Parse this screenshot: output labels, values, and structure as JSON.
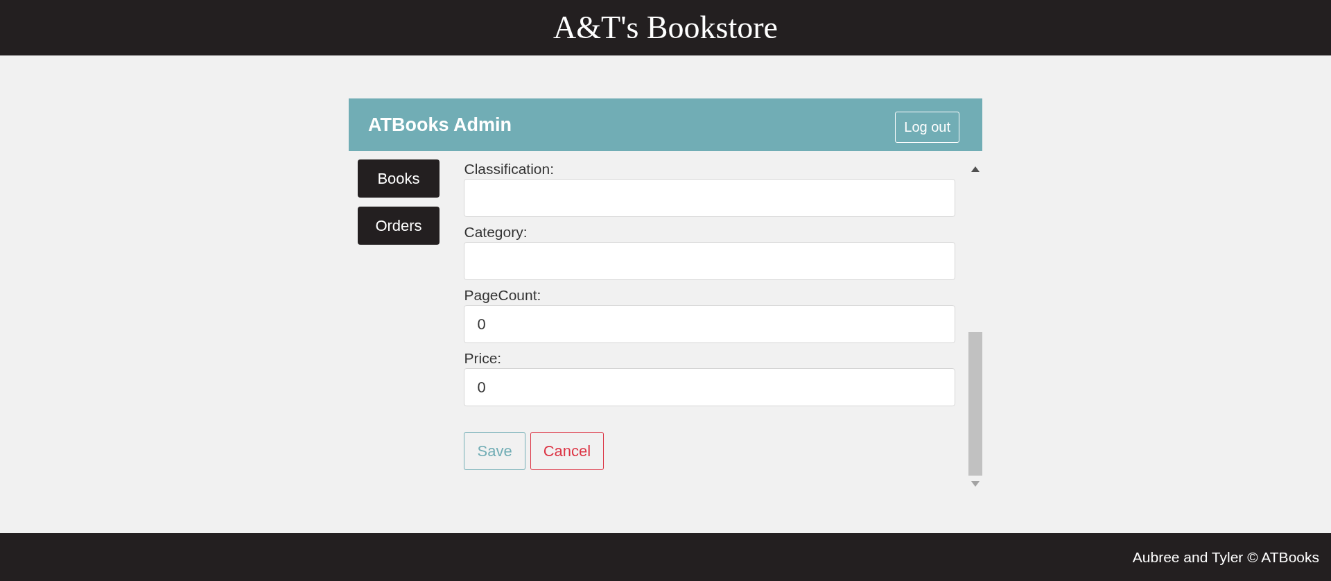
{
  "site_title": "A&T's Bookstore",
  "admin": {
    "title": "ATBooks Admin",
    "logout": "Log out"
  },
  "nav": [
    {
      "label": "Books"
    },
    {
      "label": "Orders"
    }
  ],
  "fields": [
    {
      "label": "Classification:"
    },
    {
      "label": "Category:"
    },
    {
      "label": "PageCount:",
      "value": "0"
    },
    {
      "label": "Price:",
      "value": "0"
    }
  ],
  "actions": [
    {
      "kind": "save",
      "label": "Save"
    },
    {
      "kind": "cancel",
      "label": "Cancel"
    }
  ],
  "footer": "Aubree and Tyler © ATBooks"
}
